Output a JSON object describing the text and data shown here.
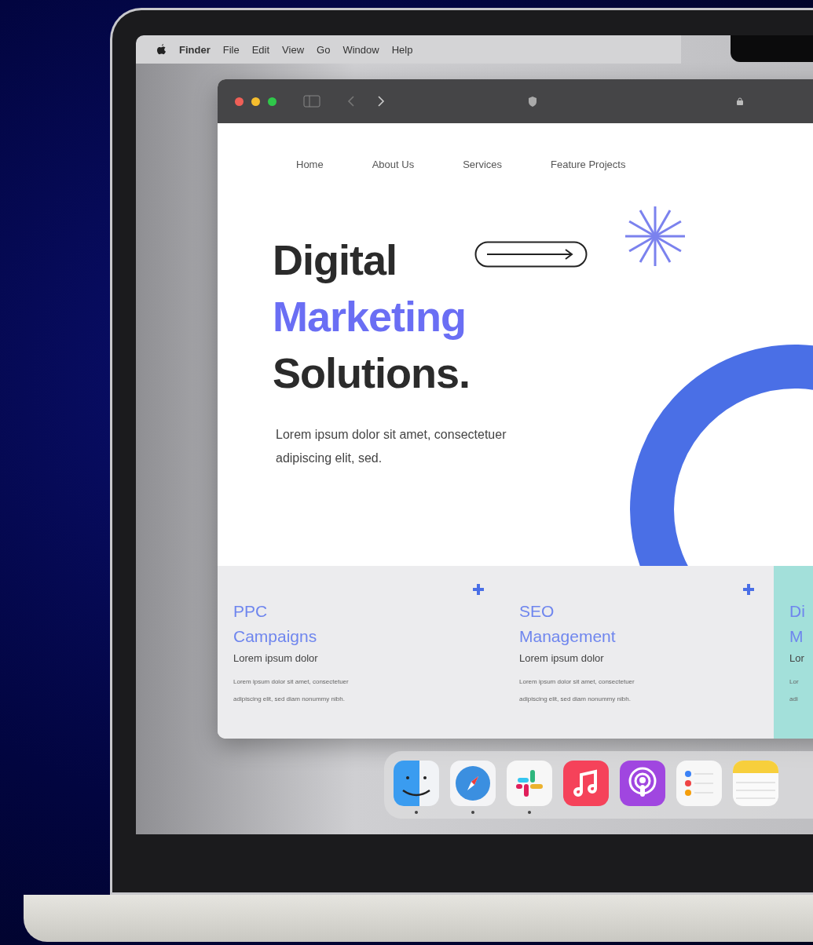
{
  "menu_bar": {
    "app": "Finder",
    "items": [
      "File",
      "Edit",
      "View",
      "Go",
      "Window",
      "Help"
    ]
  },
  "website": {
    "nav": [
      "Home",
      "About Us",
      "Services",
      "Feature Projects"
    ],
    "headline": [
      {
        "text": "Digital",
        "accent": false
      },
      {
        "text": "Marketing",
        "accent": true
      },
      {
        "text": "Solutions.",
        "accent": false
      }
    ],
    "intro": "Lorem ipsum dolor sit amet, consectetuer adipiscing elit, sed.",
    "cards": [
      {
        "title": [
          "PPC",
          "Campaigns"
        ],
        "subtitle": "Lorem ipsum dolor",
        "body": [
          "Lorem ipsum dolor sit amet, consectetuer",
          "adipiscing elit, sed diam nonummy nibh."
        ],
        "highlighted": false
      },
      {
        "title": [
          "SEO",
          "Management"
        ],
        "subtitle": "Lorem ipsum dolor",
        "body": [
          "Lorem ipsum dolor sit amet, consectetuer",
          "adipiscing elit, sed diam nonummy nibh."
        ],
        "highlighted": false
      },
      {
        "title": [
          "Di",
          "M"
        ],
        "subtitle": "Lor",
        "body": [
          "Lor",
          "adi"
        ],
        "highlighted": true
      }
    ]
  },
  "dock": [
    {
      "kind": "finder",
      "running": true
    },
    {
      "kind": "safari",
      "running": true
    },
    {
      "kind": "slack",
      "running": true
    },
    {
      "kind": "music",
      "running": false
    },
    {
      "kind": "podcasts",
      "running": false
    },
    {
      "kind": "reminders",
      "running": false
    },
    {
      "kind": "notes",
      "running": false
    }
  ]
}
